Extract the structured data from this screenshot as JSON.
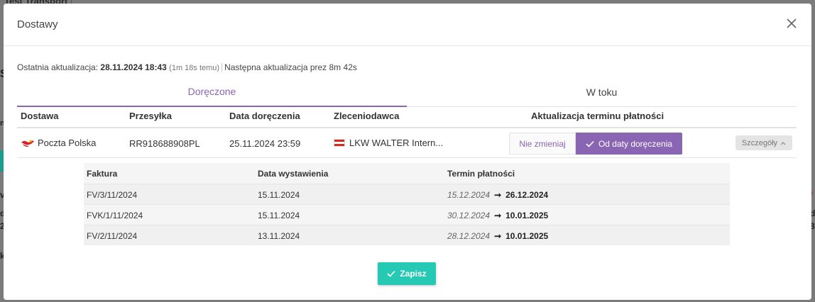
{
  "background": {
    "top_fragment": "Test Transport"
  },
  "modal": {
    "title": "Dostawy",
    "update": {
      "last_label": "Ostatnia aktualizacja: ",
      "last_value": "28.11.2024 18:43",
      "ago": "(1m 18s temu)",
      "next_label": "Następna aktualizacja prez 8m 42s"
    },
    "tabs": [
      {
        "label": "Doręczone",
        "active": true
      },
      {
        "label": "W toku",
        "active": false
      }
    ],
    "table": {
      "headers": {
        "delivery": "Dostawa",
        "shipment": "Przesyłka",
        "delivery_date": "Data doręczenia",
        "client": "Zleceniodawca",
        "payment_update": "Aktualizacja terminu płatności"
      },
      "row": {
        "carrier": "Poczta Polska",
        "tracking": "RR918688908PL",
        "date": "25.11.2024 23:59",
        "client": "LKW WALTER Intern...",
        "seg_off": "Nie zmieniaj",
        "seg_on": "Od daty doręczenia",
        "details": "Szczegóły"
      }
    },
    "invoices": {
      "headers": {
        "invoice": "Faktura",
        "issue_date": "Data wystawienia",
        "due": "Termin płatności"
      },
      "rows": [
        {
          "invoice": "FV/3/11/2024",
          "issued": "15.11.2024",
          "old": "15.12.2024",
          "new": "26.12.2024"
        },
        {
          "invoice": "FVK/1/11/2024",
          "issued": "15.11.2024",
          "old": "30.12.2024",
          "new": "10.01.2025"
        },
        {
          "invoice": "FV/2/11/2024",
          "issued": "13.11.2024",
          "old": "28.12.2024",
          "new": "10.01.2025"
        }
      ]
    },
    "save_label": "Zapisz"
  },
  "colors": {
    "accent": "#8a65b4",
    "save": "#26c9b4"
  }
}
